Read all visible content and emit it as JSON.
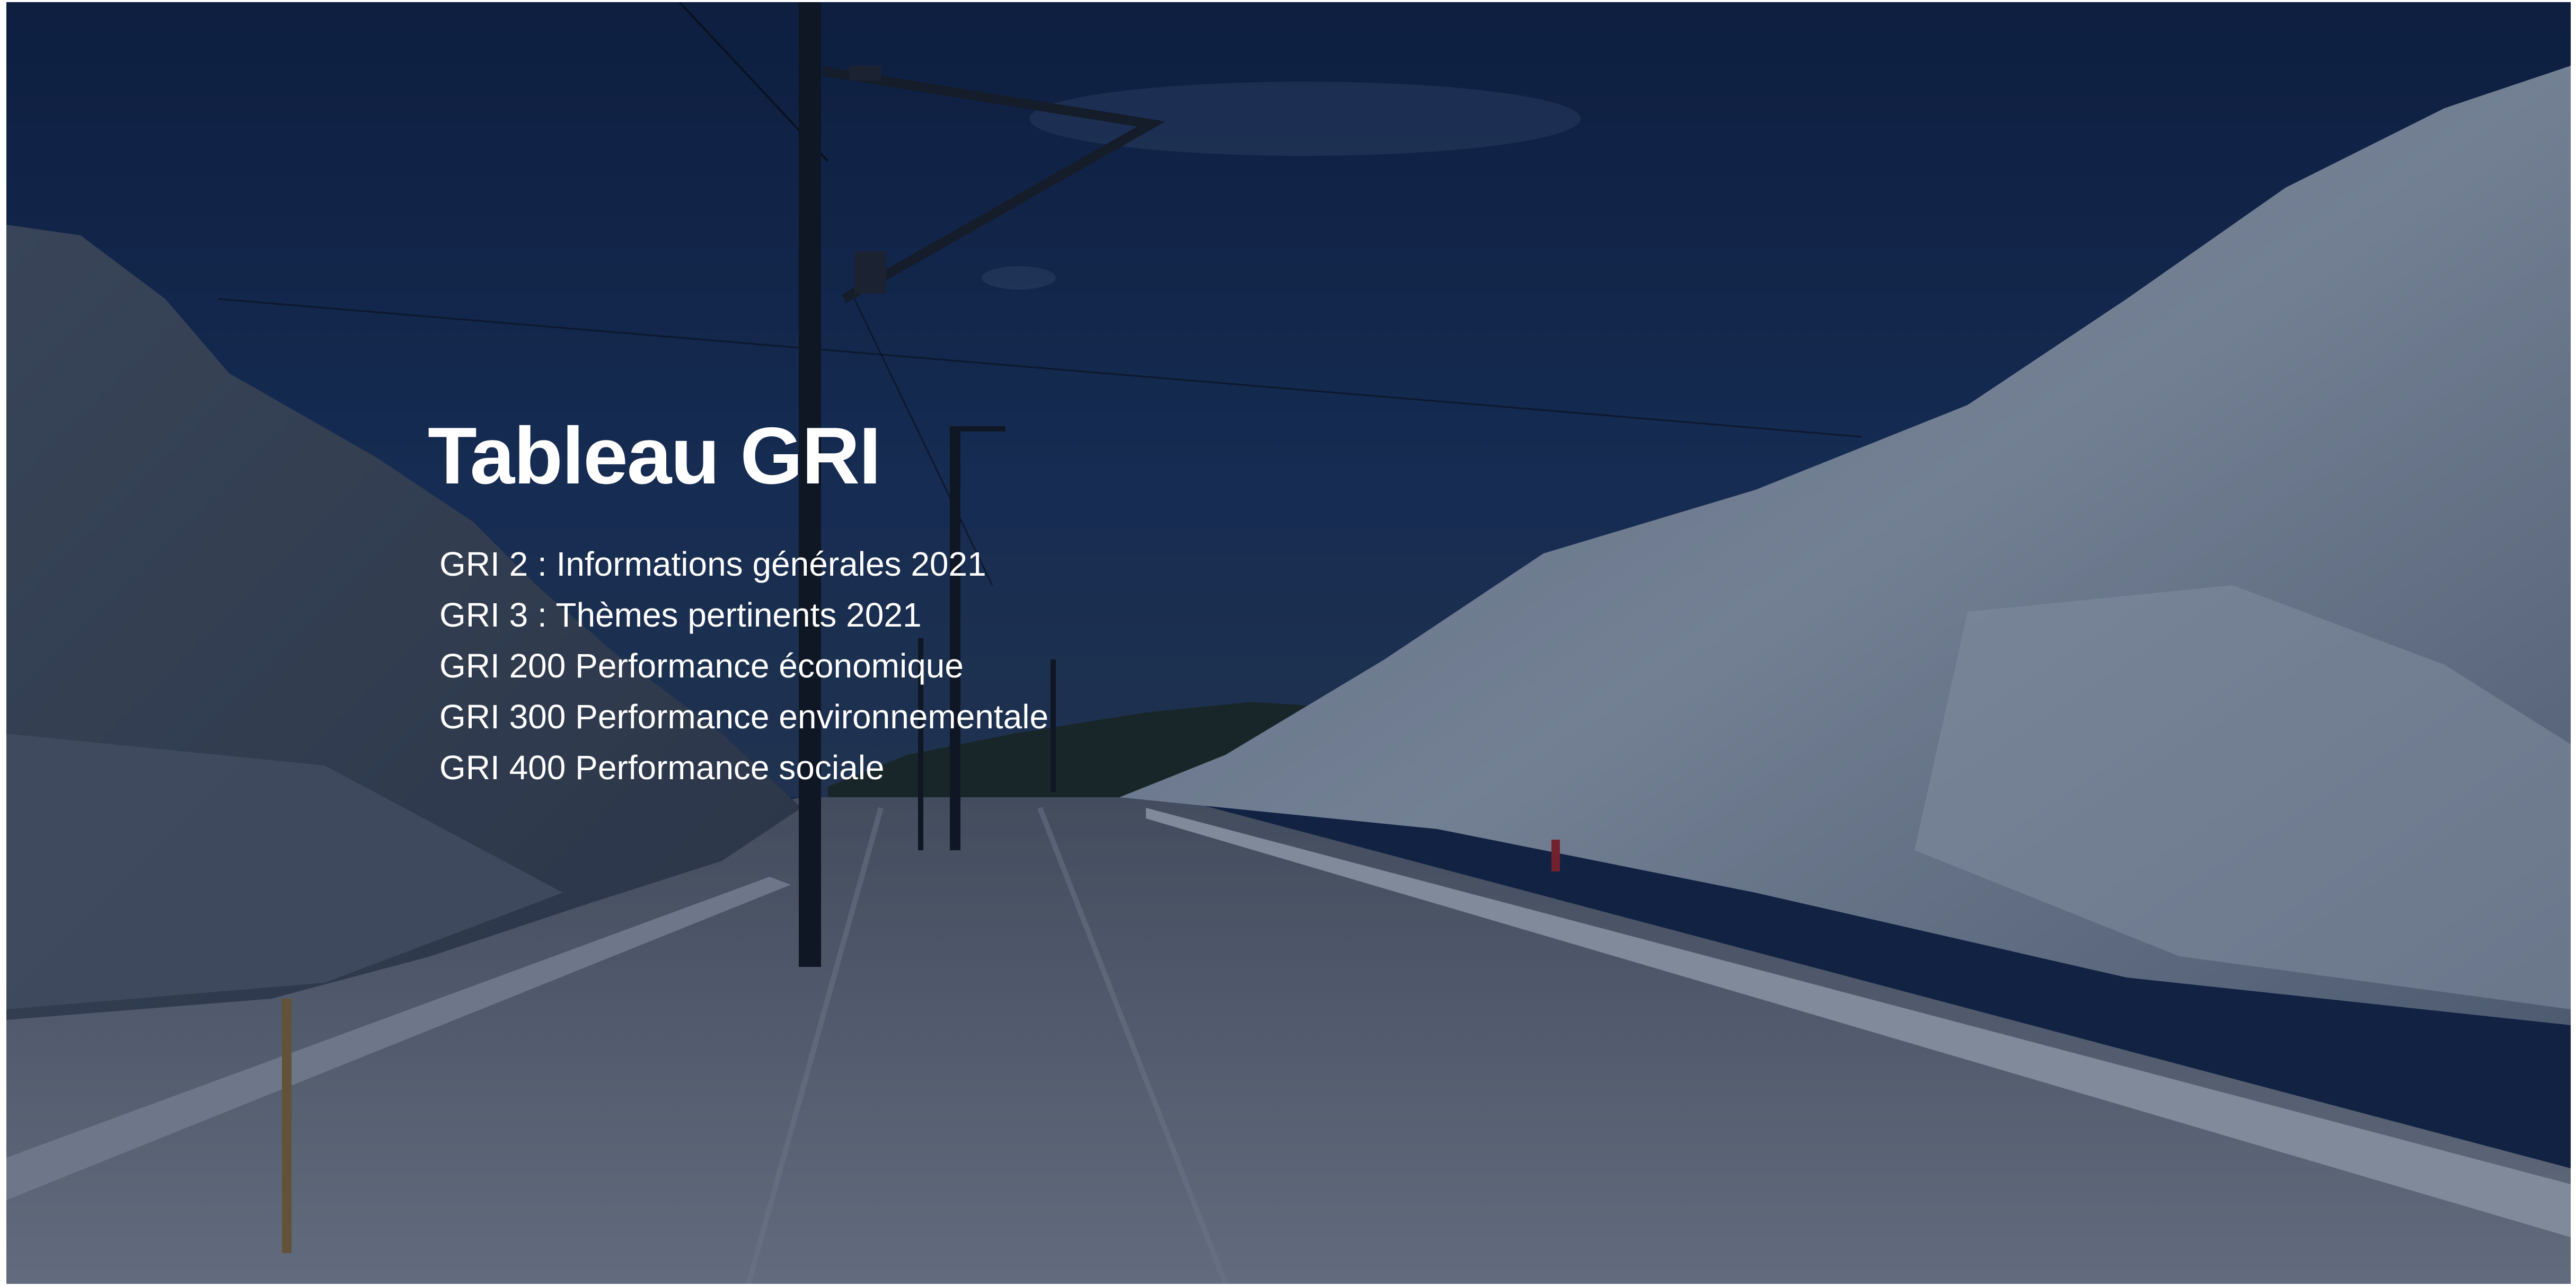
{
  "hero": {
    "title": "Tableau GRI",
    "links": [
      {
        "label": "GRI 2 : Informations générales 2021"
      },
      {
        "label": "GRI 3 : Thèmes pertinents 2021"
      },
      {
        "label": "GRI 200 Performance économique"
      },
      {
        "label": "GRI 300 Performance environnementale"
      },
      {
        "label": "GRI 400 Performance sociale"
      }
    ]
  },
  "colors": {
    "sky": "#14274a",
    "rock": "#8a99ad",
    "gravel": "#7f8895",
    "text": "#ffffff"
  }
}
